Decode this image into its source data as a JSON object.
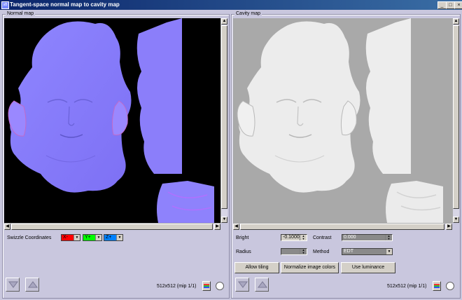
{
  "window": {
    "title": "Tangent-space normal map to cavity map",
    "app_icon": "sB",
    "minimize": "_",
    "maximize": "□",
    "close": "×"
  },
  "normal_panel": {
    "label": "Normal map",
    "swizzle_label": "Swizzle Coordinates",
    "swizzle": [
      {
        "value": "X-",
        "color": "#ff0000"
      },
      {
        "value": "Y+",
        "color": "#00ff00"
      },
      {
        "value": "Z+",
        "color": "#0080ff"
      }
    ],
    "status": "512x512 (mip 1/1)"
  },
  "cavity_panel": {
    "label": "Cavity map",
    "bright_label": "Bright",
    "bright_value": "-0.1000",
    "contrast_label": "Contrast",
    "contrast_value": "0.000",
    "radius_label": "Radius",
    "radius_value": "",
    "method_label": "Method",
    "method_value": "EDT",
    "allow_tiling": "Allow tiling",
    "normalize": "Normalize image colors",
    "use_luminance": "Use luminance",
    "status": "512x512 (mip 1/1)"
  },
  "icons": [
    "app-icon",
    "up-arrow-icon",
    "down-arrow-icon",
    "color-bars-icon",
    "circle-icon"
  ],
  "colors": {
    "normal_map": "#8a7dfa",
    "cavity_map": "#ececec",
    "cavity_bg": "#a9a9a9",
    "titlebar": "#0a246a"
  }
}
